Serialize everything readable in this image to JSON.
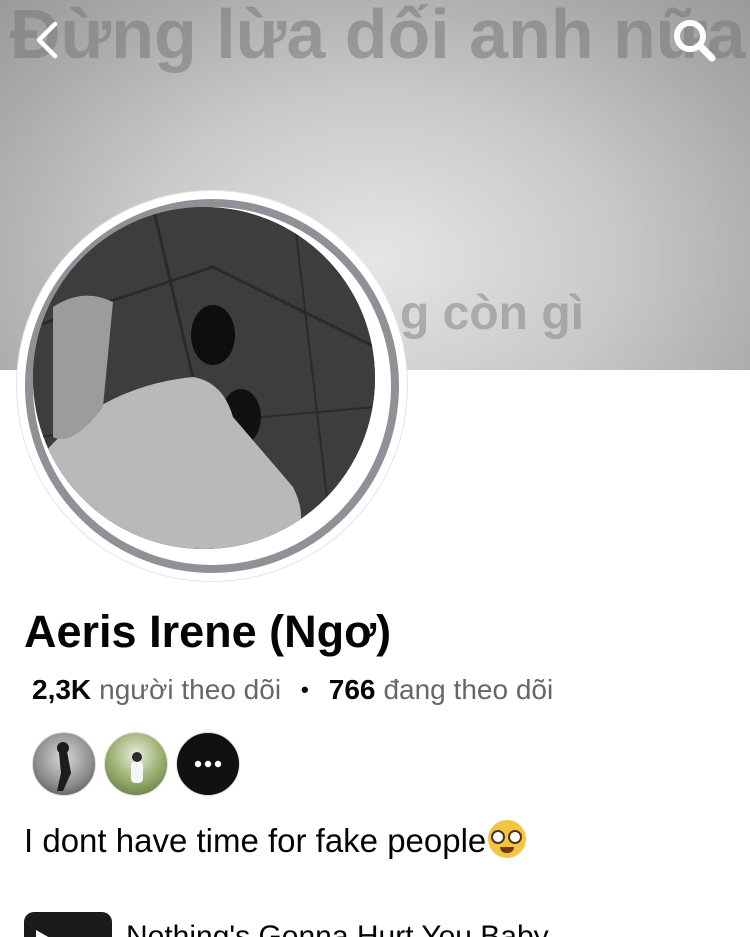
{
  "cover": {
    "text_top": "Đừng lừa dối anh nữa",
    "text_bottom": "g còn gì"
  },
  "nav": {
    "back_icon": "chevron-left-icon",
    "search_icon": "search-icon"
  },
  "profile": {
    "name": "Aeris Irene (Ngơ)",
    "followers_count": "2,3K",
    "followers_label": "người theo dõi",
    "separator": "•",
    "following_count": "766",
    "following_label": "đang theo dõi",
    "bio": "I dont have time for fake people"
  },
  "friends": {
    "more_icon": "more-dots-icon"
  },
  "music": {
    "title": "Nothing's Gonna Hurt You Baby"
  },
  "colors": {
    "text_primary": "#050505",
    "text_secondary": "#65676b",
    "avatar_ring": "#8f9196"
  }
}
